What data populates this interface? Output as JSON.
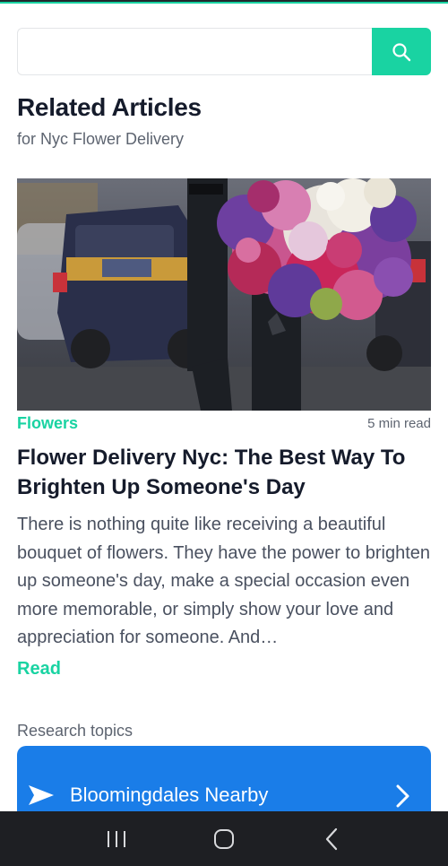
{
  "search": {
    "placeholder": "",
    "value": "",
    "button_icon": "search-icon"
  },
  "section": {
    "title": "Related Articles",
    "subtitle": "for Nyc Flower Delivery"
  },
  "article": {
    "category": "Flowers",
    "read_time": "5 min read",
    "title": "Flower Delivery Nyc: The Best Way To Brighten Up Someone's Day",
    "excerpt": "There is nothing quite like receiving a beautiful bouquet of flowers. They have the power to brighten up someone's day, make a special occasion even more memorable, or simply show your love and appreciation for someone. And…",
    "read_label": "Read",
    "image_icon": "flower-bouquet-photo"
  },
  "topics": {
    "label": "Research topics",
    "items": [
      {
        "label": "Bloomingdales Nearby",
        "icon": "send-arrow-icon",
        "chevron": "chevron-right-icon"
      }
    ]
  },
  "nav": {
    "recents_icon": "recents-icon",
    "home_icon": "home-icon",
    "back_icon": "back-icon"
  },
  "colors": {
    "accent": "#19d3a2",
    "title": "#151b2b",
    "muted": "#5d6470",
    "topic_card": "#1a7de8",
    "nav_bar": "#1e1f23"
  }
}
